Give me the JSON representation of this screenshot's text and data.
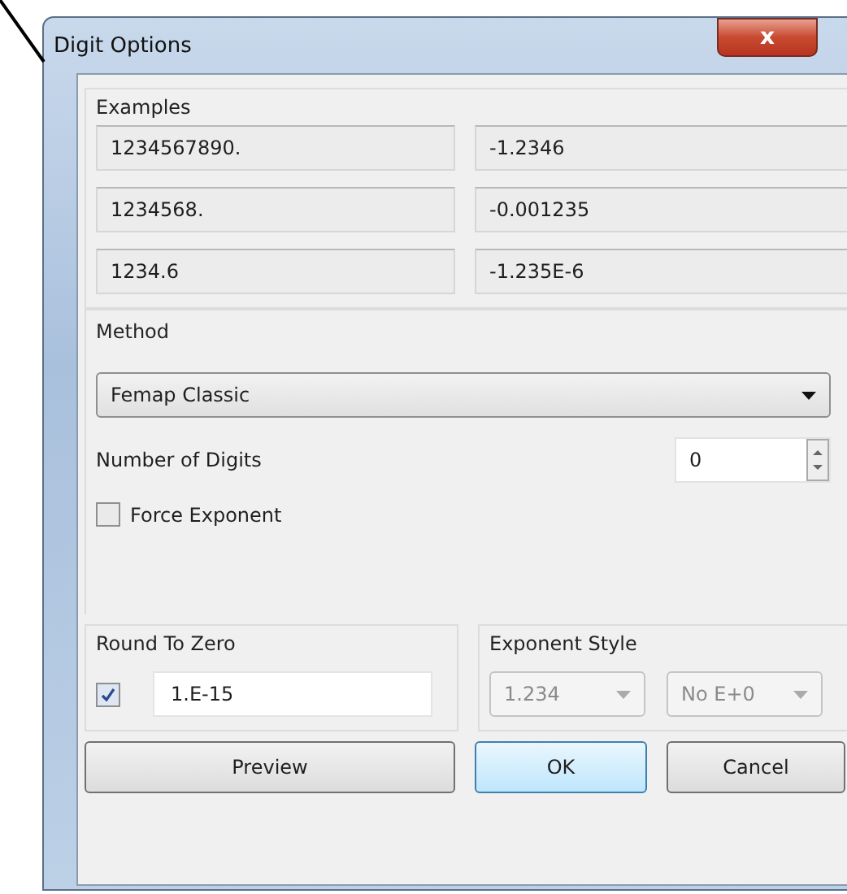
{
  "window": {
    "title": "Digit Options",
    "close": "x"
  },
  "examples": {
    "title": "Examples",
    "rows": [
      [
        "1234567890.",
        "-1.2346"
      ],
      [
        "1234568.",
        "-0.001235"
      ],
      [
        "1234.6",
        "-1.235E-6"
      ]
    ]
  },
  "method": {
    "title": "Method",
    "dropdown": "Femap Classic",
    "digits_label": "Number of Digits",
    "digits_value": "0",
    "force_exponent": {
      "label": "Force Exponent",
      "checked": false
    }
  },
  "round_to_zero": {
    "title": "Round To Zero",
    "checked": true,
    "value": "1.E-15"
  },
  "exponent_style": {
    "title": "Exponent Style",
    "dropdowns": [
      {
        "value": "1.234",
        "disabled": true
      },
      {
        "value": "No E+0",
        "disabled": true
      }
    ]
  },
  "buttons": [
    {
      "label": "Preview",
      "default": false
    },
    {
      "label": "OK",
      "default": true
    },
    {
      "label": "Cancel",
      "default": false
    }
  ]
}
